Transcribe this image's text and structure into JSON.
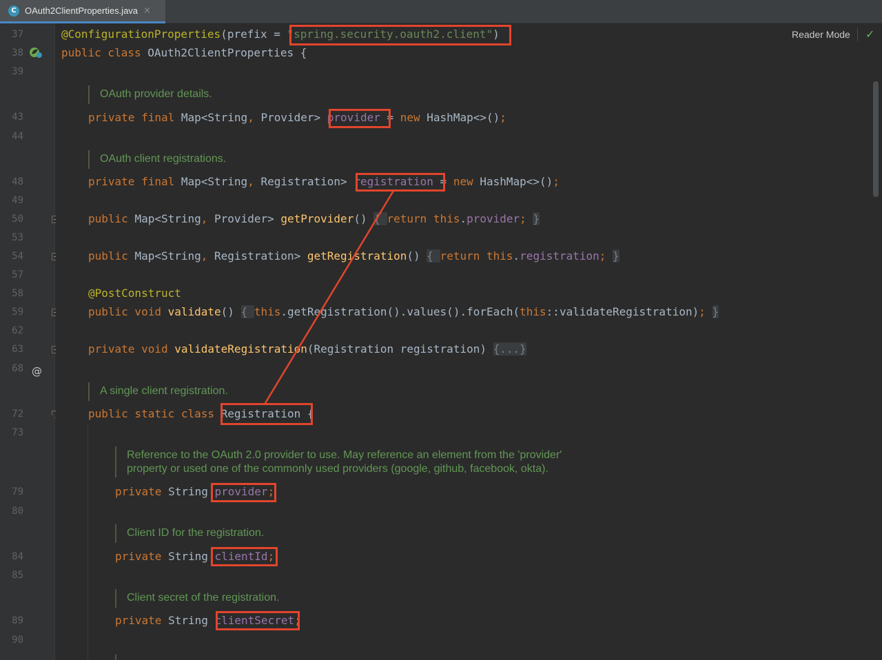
{
  "tab": {
    "title": "OAuth2ClientProperties.java",
    "icon": "C",
    "close": "×"
  },
  "toolbar": {
    "reader_mode": "Reader Mode",
    "check_icon": "✓"
  },
  "gutter": {
    "line_numbers": [
      "37",
      "38",
      "39",
      "43",
      "44",
      "48",
      "49",
      "50",
      "53",
      "54",
      "57",
      "58",
      "59",
      "62",
      "63",
      "68",
      "72",
      "73",
      "79",
      "80",
      "84",
      "85",
      "89",
      "90"
    ],
    "at_icon": "@"
  },
  "code": {
    "l37_ann": "@ConfigurationProperties",
    "l37_open": "(prefix = ",
    "l37_str": "\"spring.security.oauth2.client\"",
    "l37_close": ")",
    "l38_kw": "public class ",
    "l38_name": "OAuth2ClientProperties {",
    "doc1": "OAuth provider details.",
    "l43_kw": "private final ",
    "l43_type": "Map<String",
    "l43_comma": ", ",
    "l43_type2": "Provider> ",
    "l43_field": "provider",
    "l43_eq": " = ",
    "l43_new": "new ",
    "l43_rest": "HashMap<>()",
    "l43_semi": ";",
    "doc2": "OAuth client registrations.",
    "l48_kw": "private final ",
    "l48_type": "Map<String",
    "l48_comma": ", ",
    "l48_type2": "Registration> ",
    "l48_field": "registration",
    "l48_eq": " = ",
    "l48_new": "new ",
    "l48_rest": "HashMap<>()",
    "l48_semi": ";",
    "l50_kw": "public ",
    "l50_type": "Map<String",
    "l50_comma": ", ",
    "l50_type2": "Provider> ",
    "l50_method": "getProvider",
    "l50_paren": "() ",
    "l50_body_open": "{ ",
    "l50_ret": "return this",
    "l50_dot": ".",
    "l50_field": "provider",
    "l50_semi": "; ",
    "l50_body_close": "}",
    "l54_kw": "public ",
    "l54_type": "Map<String",
    "l54_comma": ", ",
    "l54_type2": "Registration> ",
    "l54_method": "getRegistration",
    "l54_paren": "() ",
    "l54_body_open": "{ ",
    "l54_ret": "return this",
    "l54_dot": ".",
    "l54_field": "registration",
    "l54_semi": "; ",
    "l54_body_close": "}",
    "l58_ann": "@PostConstruct",
    "l59_kw": "public void ",
    "l59_method": "validate",
    "l59_paren": "() ",
    "l59_body_open": "{ ",
    "l59_this": "this",
    "l59_call": ".getRegistration().values().forEach(",
    "l59_this2": "this",
    "l59_ref": "::validateRegistration)",
    "l59_semi": "; ",
    "l59_body_close": "}",
    "l63_kw": "private void ",
    "l63_method": "validateRegistration",
    "l63_params": "(Registration registration) ",
    "l63_folded": "{...}",
    "doc3": "A single client registration.",
    "l72_kw": "public static class ",
    "l72_name": "Registration ",
    "l72_brace": "{",
    "doc4_line1": "Reference to the OAuth 2.0 provider to use. May reference an element from the 'provider'",
    "doc4_line2": "property or used one of the commonly used providers (google, github, facebook, okta).",
    "l79_kw": "private ",
    "l79_type": "String ",
    "l79_field": "provider",
    "l79_semi": ";",
    "doc5": "Client ID for the registration.",
    "l84_kw": "private ",
    "l84_type": "String ",
    "l84_field": "clientId",
    "l84_semi": ";",
    "doc6": "Client secret of the registration.",
    "l89_kw": "private ",
    "l89_type": "String ",
    "l89_field": "clientSecret",
    "l89_semi": ";"
  },
  "colors": {
    "highlight": "#e2452d",
    "keyword": "#cc7832",
    "annotation": "#bbb529",
    "string": "#6a8759",
    "field": "#9876aa",
    "method": "#ffc66d",
    "doc": "#629755"
  }
}
